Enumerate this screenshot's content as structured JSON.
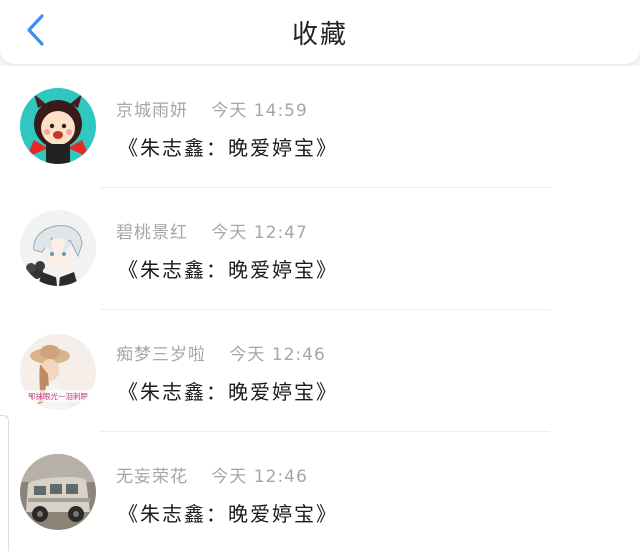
{
  "header": {
    "title": "收藏",
    "back_icon": "chevron-left-icon",
    "accent": "#3b8ff0"
  },
  "items": [
    {
      "name": "京城雨妍",
      "time": "今天 14:59",
      "message": "《朱志鑫：晚爱婷宝》",
      "avatar": "cartoon-devil-girl"
    },
    {
      "name": "碧桃景红",
      "time": "今天 12:47",
      "message": "《朱志鑫：晚爱婷宝》",
      "avatar": "anime-white-hair-boy"
    },
    {
      "name": "痴梦三岁啦",
      "time": "今天 12:46",
      "message": "《朱志鑫：晚爱婷宝》",
      "avatar": "girl-with-hat",
      "avatar_caption": "那抹眼光一泪刺眼"
    },
    {
      "name": "无妄荣花",
      "time": "今天 12:46",
      "message": "《朱志鑫：晚爱婷宝》",
      "avatar": "vintage-van"
    }
  ]
}
